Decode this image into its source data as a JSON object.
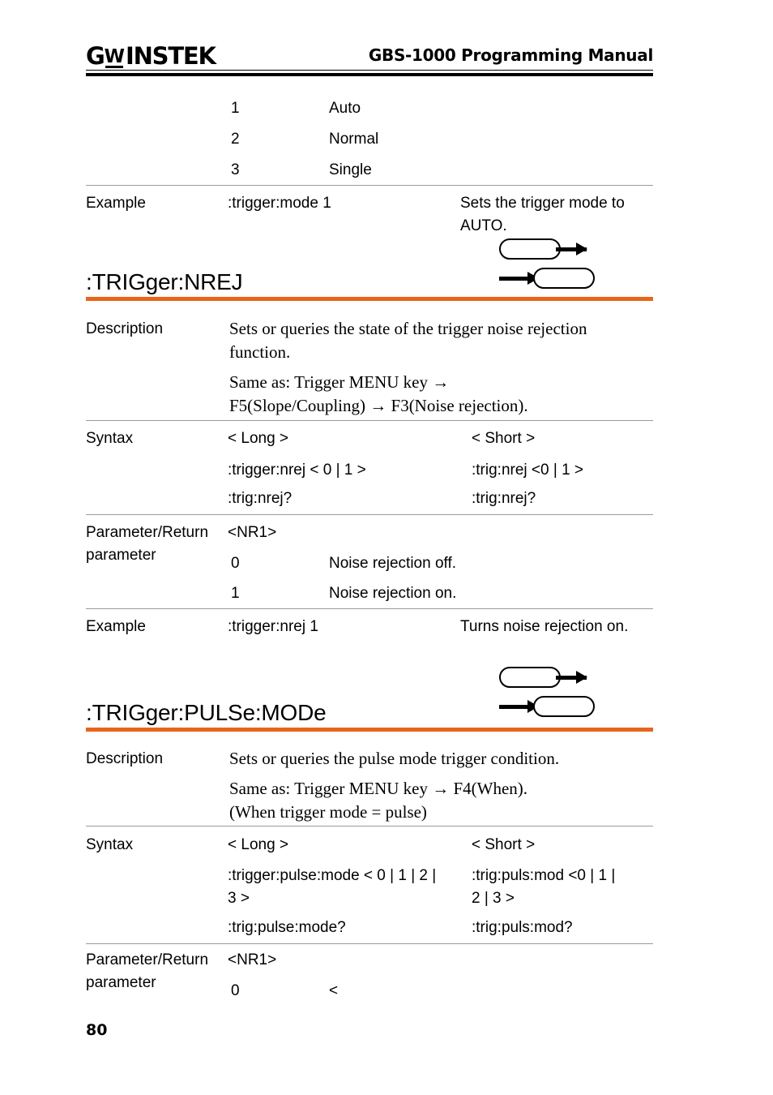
{
  "header": {
    "logo_gw": "G",
    "logo_w": "W",
    "logo_instek": "INSTEK",
    "title": "GBS-1000 Programming Manual"
  },
  "colors": {
    "rule_orange": "#e8651c",
    "rule_gray": "#9a9a9a",
    "text": "#000000"
  },
  "sections": [
    {
      "id": "trigger-mode-continued",
      "enum_rows": [
        {
          "value": "1",
          "desc": "Auto"
        },
        {
          "value": "2",
          "desc": "Normal"
        },
        {
          "value": "3",
          "desc": "Single"
        }
      ],
      "example": {
        "label": "Example",
        "command": ":trigger:mode 1",
        "result": "Sets the trigger mode to AUTO."
      }
    },
    {
      "id": "trigger-nrej",
      "heading": ":TRIGger:NREJ",
      "description": {
        "label": "Description",
        "paragraphs": [
          "Sets or queries the state of the trigger noise rejection function.",
          "Same as: Trigger MENU key →\nF5(Slope/Coupling) → F3(Noise rejection)."
        ]
      },
      "syntax": {
        "label": "Syntax",
        "long_header": "< Long >",
        "short_header": "< Short >",
        "long_lines": [
          ":trigger:nrej < 0 | 1 >",
          ":trig:nrej?"
        ],
        "short_lines": [
          ":trig:nrej <0 | 1 >",
          ":trig:nrej?"
        ]
      },
      "parameter": {
        "label": "Parameter/Return\nparameter",
        "type": "<NR1>",
        "rows": [
          {
            "value": "0",
            "desc": "Noise rejection off."
          },
          {
            "value": "1",
            "desc": "Noise rejection on."
          }
        ]
      },
      "example": {
        "label": "Example",
        "command": ":trigger:nrej 1",
        "result": "Turns noise rejection on."
      }
    },
    {
      "id": "trigger-pulse-mode",
      "heading": ":TRIGger:PULSe:MODe",
      "description": {
        "label": "Description",
        "paragraphs": [
          "Sets or queries the pulse mode trigger condition.",
          "Same as: Trigger MENU key → F4(When).\n(When trigger mode = pulse)"
        ]
      },
      "syntax": {
        "label": "Syntax",
        "long_header": "< Long >",
        "short_header": "< Short >",
        "long_lines": [
          ":trigger:pulse:mode < 0 | 1 | 2 |\n3 >",
          ":trig:pulse:mode?"
        ],
        "short_lines": [
          ":trig:puls:mod <0 | 1 |\n2 | 3 >",
          ":trig:puls:mod?"
        ]
      },
      "parameter": {
        "label": "Parameter/Return\nparameter",
        "type": "<NR1>",
        "rows": [
          {
            "value": "0",
            "desc": "<"
          }
        ]
      }
    }
  ],
  "footer": {
    "page_number": "80"
  }
}
